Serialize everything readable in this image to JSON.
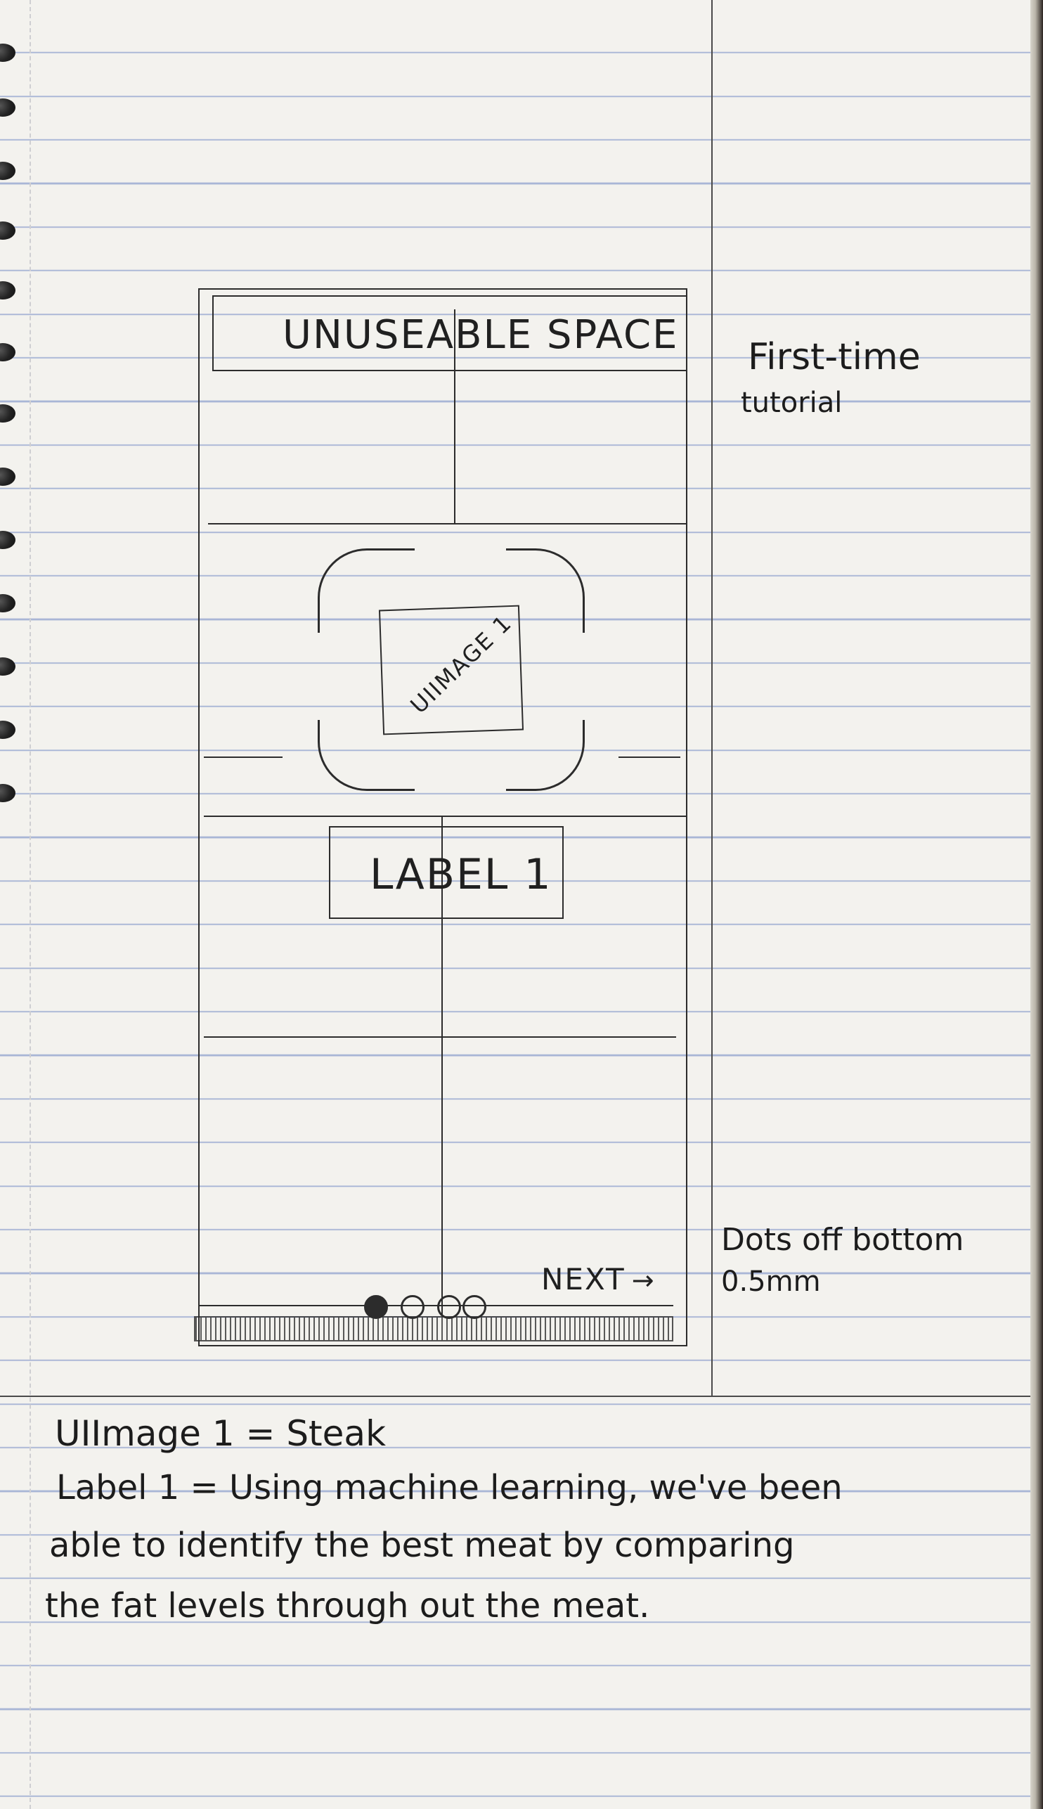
{
  "sketch": {
    "unusable_space_label": "UNUSEABLE SPACE",
    "image_label": "UIIMAGE 1",
    "label1_text": "LABEL 1",
    "next_button_label": "NEXT",
    "next_arrow": "→"
  },
  "side_notes": {
    "tutorial_line1": "First-time",
    "tutorial_line2": "tutorial",
    "dots_line1": "Dots off bottom",
    "dots_line2": "0.5mm"
  },
  "notes": {
    "line1": "UIImage 1 = Steak",
    "line2": "Label 1 = Using machine learning, we've been",
    "line3": "able to identify the best meat by comparing",
    "line4": "the fat levels through out the meat."
  },
  "page_dots": {
    "count": 4,
    "active_index": 0
  }
}
